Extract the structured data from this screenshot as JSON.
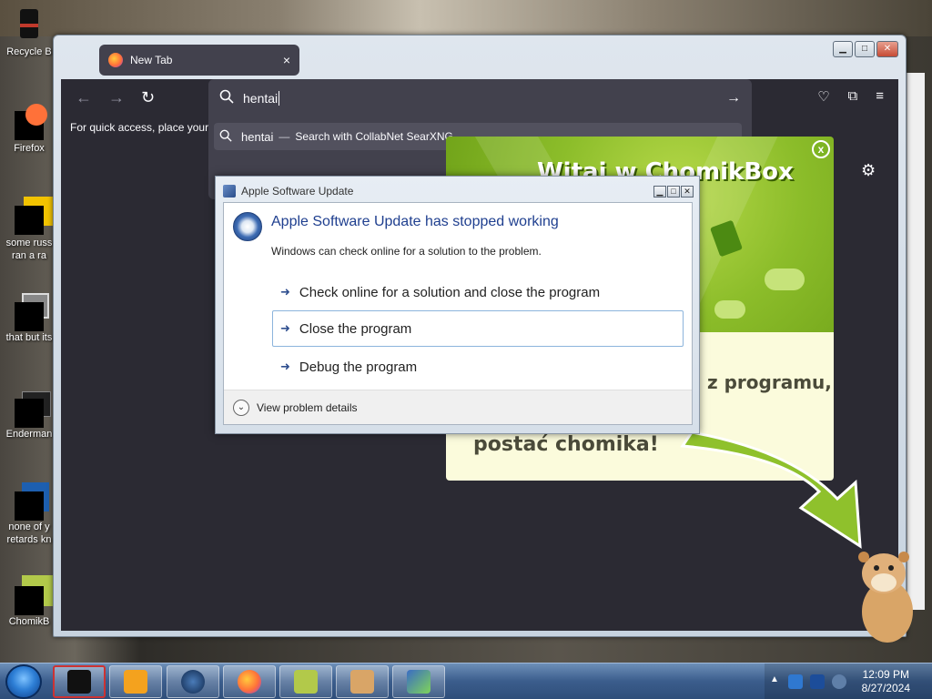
{
  "desktop": {
    "icons": [
      {
        "label": "Recycle B"
      },
      {
        "label": "Firefox"
      },
      {
        "label": "some russ ran a ra"
      },
      {
        "label": "that but its"
      },
      {
        "label": "Enderman"
      },
      {
        "label": "none of y retards kn"
      },
      {
        "label": "ChomikB"
      }
    ]
  },
  "firefox": {
    "tab_title": "New Tab",
    "tab_close": "×",
    "bookmark_hint": "For quick access, place your b",
    "urlbar_value": "hentai",
    "suggestion_query": "hentai",
    "suggestion_separator": "—",
    "suggestion_action": "Search with CollabNet SearXNG"
  },
  "chomikbox": {
    "title": "Witaj w ChomikBox",
    "close_label": "x",
    "text_line1": "z programu,",
    "text_line2": "postać chomika!"
  },
  "dialog": {
    "title": "Apple Software Update",
    "heading": "Apple Software Update has stopped working",
    "subtext": "Windows can check online for a solution to the problem.",
    "options": [
      {
        "label": "Check online for a solution and close the program"
      },
      {
        "label": "Close the program"
      },
      {
        "label": "Debug the program"
      }
    ],
    "details_label": "View problem details"
  },
  "taskbar": {
    "time": "12:09 PM",
    "date": "8/27/2024"
  },
  "colors": {
    "firefox_dark": "#2b2a33",
    "urlbar": "#42414d",
    "chomik_green": "#8cbd2a",
    "chomik_yellow": "#fbfbdc",
    "dialog_heading": "#1f3f8f",
    "taskbar": "#3b5d8c"
  }
}
